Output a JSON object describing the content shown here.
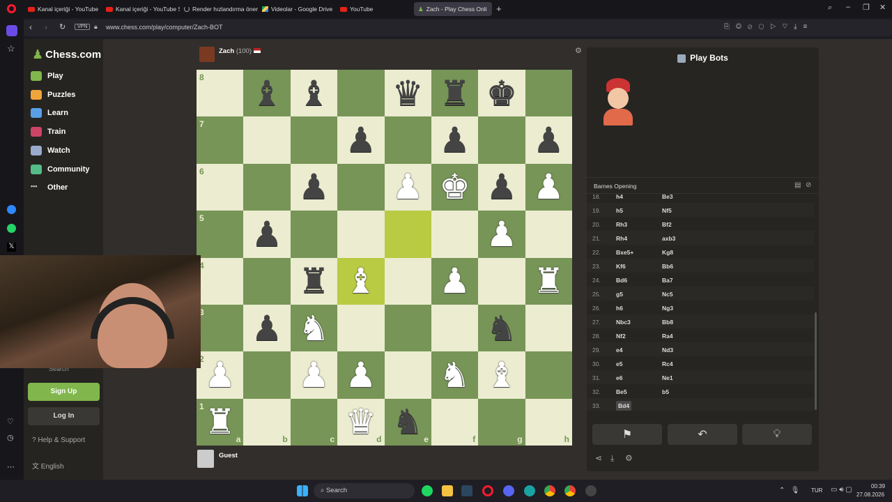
{
  "browser": {
    "tabs": [
      {
        "label": "Kanal içeriği - YouTube St",
        "icon": "youtube"
      },
      {
        "label": "Kanal içeriği - YouTube St",
        "icon": "youtube"
      },
      {
        "label": "Render hızlandırma öneril",
        "icon": "loading"
      },
      {
        "label": "Videolar - Google Drive",
        "icon": "drive"
      },
      {
        "label": "YouTube",
        "icon": "youtube"
      },
      {
        "label": "Zach - Play Chess Onli",
        "icon": "chess"
      }
    ],
    "url": "www.chess.com/play/computer/Zach-BOT",
    "vpn": "VPN"
  },
  "nav": {
    "logo": "Chess.com",
    "items": [
      "Play",
      "Puzzles",
      "Learn",
      "Train",
      "Watch",
      "Community",
      "Other"
    ],
    "search": "Search",
    "signup": "Sign Up",
    "login": "Log In",
    "help": "Help & Support",
    "language": "English"
  },
  "opponent": {
    "name": "Zach",
    "rating": "(100)"
  },
  "player": {
    "name": "Guest"
  },
  "board": {
    "ranks": [
      "8",
      "7",
      "6",
      "5",
      "4",
      "3",
      "2",
      "1"
    ],
    "files": [
      "a",
      "b",
      "c",
      "d",
      "e",
      "f",
      "g",
      "h"
    ],
    "rows": [
      [
        "",
        "bB",
        "bB",
        "",
        "bQ",
        "bR",
        "bK",
        ""
      ],
      [
        "",
        "",
        "",
        "bP",
        "",
        "bP",
        "",
        "bP"
      ],
      [
        "",
        "",
        "bP",
        "",
        "wP",
        "wK",
        "bP",
        "wP"
      ],
      [
        "",
        "bP",
        "",
        "",
        "",
        "",
        "wP",
        ""
      ],
      [
        "",
        "",
        "bR",
        "wB",
        "",
        "wP",
        "",
        "wR"
      ],
      [
        "",
        "bP",
        "wN",
        "",
        "",
        "",
        "bN",
        ""
      ],
      [
        "wP",
        "",
        "wP",
        "wP",
        "",
        "wN",
        "wB",
        ""
      ],
      [
        "wR",
        "",
        "",
        "wQ",
        "bN",
        "",
        "",
        ""
      ]
    ],
    "highlight": [
      "d4",
      "e5"
    ]
  },
  "panel": {
    "title": "Play Bots",
    "opening": "Barnes Opening",
    "moves": [
      {
        "n": "18.",
        "w": "h4",
        "b": "Be3"
      },
      {
        "n": "19.",
        "w": "h5",
        "b": "Nf5"
      },
      {
        "n": "20.",
        "w": "Rh3",
        "b": "Bf2"
      },
      {
        "n": "21.",
        "w": "Rh4",
        "b": "axb3"
      },
      {
        "n": "22.",
        "w": "Bxe5+",
        "b": "Kg8"
      },
      {
        "n": "23.",
        "w": "Kf6",
        "b": "Bb6"
      },
      {
        "n": "24.",
        "w": "Bd6",
        "b": "Ba7"
      },
      {
        "n": "25.",
        "w": "g5",
        "b": "Nc5"
      },
      {
        "n": "26.",
        "w": "h6",
        "b": "Ng3"
      },
      {
        "n": "27.",
        "w": "Nbc3",
        "b": "Bb8"
      },
      {
        "n": "28.",
        "w": "Nf2",
        "b": "Ra4"
      },
      {
        "n": "29.",
        "w": "e4",
        "b": "Nd3"
      },
      {
        "n": "30.",
        "w": "e5",
        "b": "Rc4"
      },
      {
        "n": "31.",
        "w": "e6",
        "b": "Ne1"
      },
      {
        "n": "32.",
        "w": "Be5",
        "b": "b5"
      },
      {
        "n": "33.",
        "w": "Bd4",
        "b": ""
      }
    ]
  },
  "taskbar": {
    "search": "Search",
    "lang": "TUR",
    "time": "00:39",
    "date": "27.08.2026"
  }
}
